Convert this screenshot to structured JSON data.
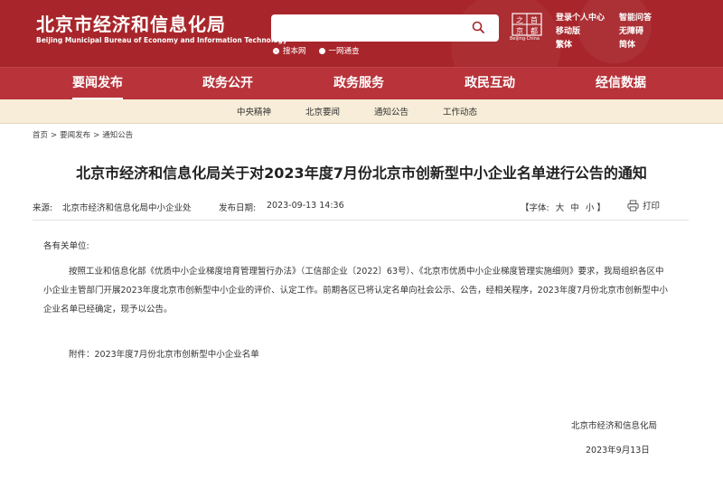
{
  "header": {
    "site_title": "北京市经济和信息化局",
    "site_subtitle": "Beijing Municipal Bureau of Economy and Information Technology",
    "search_placeholder": "",
    "search_options": [
      {
        "label": "搜本网",
        "selected": true
      },
      {
        "label": "一网通查",
        "selected": false
      }
    ],
    "logo_caption": "Beijing·China",
    "top_links": [
      "登录个人中心",
      "智能问答",
      "移动版",
      "无障碍",
      "繁体",
      "简体"
    ]
  },
  "main_nav": [
    "要闻发布",
    "政务公开",
    "政务服务",
    "政民互动",
    "经信数据"
  ],
  "main_nav_active": "要闻发布",
  "sub_nav": [
    "中央精神",
    "北京要闻",
    "通知公告",
    "工作动态"
  ],
  "breadcrumb": [
    "首页",
    "要闻发布",
    "通知公告"
  ],
  "article": {
    "title": "北京市经济和信息化局关于对2023年度7月份北京市创新型中小企业名单进行公告的通知",
    "source_label": "来源:",
    "source": "北京市经济和信息化局中小企业处",
    "date_label": "发布日期:",
    "date": "2023-09-13 14:36",
    "font_label": "【字体:",
    "font_sizes": [
      "大",
      "中",
      "小"
    ],
    "font_close": "】",
    "print_label": "打印",
    "salutation": "各有关单位:",
    "paragraph": "按照工业和信息化部《优质中小企业梯度培育管理暂行办法》（工信部企业〔2022〕63号）、《北京市优质中小企业梯度管理实施细则》要求，我局组织各区中小企业主管部门开展2023年度北京市创新型中小企业的评价、认定工作。前期各区已将认定名单向社会公示、公告，经相关程序，2023年度7月份北京市创新型中小企业名单已经确定，现予以公告。",
    "attachment": "附件：2023年度7月份北京市创新型中小企业名单",
    "signature": "北京市经济和信息化局",
    "sign_date": "2023年9月13日"
  },
  "colors": {
    "header_bg": "#a8262b",
    "nav_bg": "#b8333a",
    "subnav_bg": "#f7edd8"
  }
}
